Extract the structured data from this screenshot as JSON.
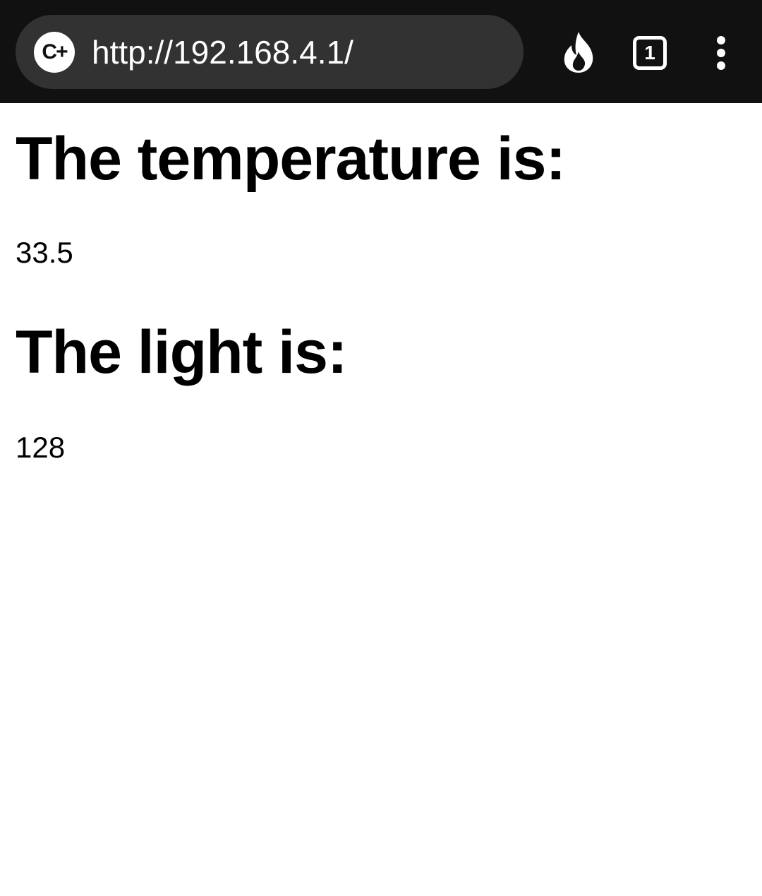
{
  "browser": {
    "url": "http://192.168.4.1/",
    "site_icon_text": "C+",
    "site_icon": "site-info-icon",
    "flame_icon": "flame-icon",
    "tab_count": "1",
    "menu_icon": "more-vert-icon"
  },
  "page": {
    "temperature_heading": "The temperature is:",
    "temperature_value": "33.5",
    "light_heading": "The light is:",
    "light_value": "128"
  },
  "colors": {
    "toolbar_bg": "#111111",
    "omnibox_bg": "#323232",
    "page_bg": "#ffffff",
    "text": "#000000"
  }
}
